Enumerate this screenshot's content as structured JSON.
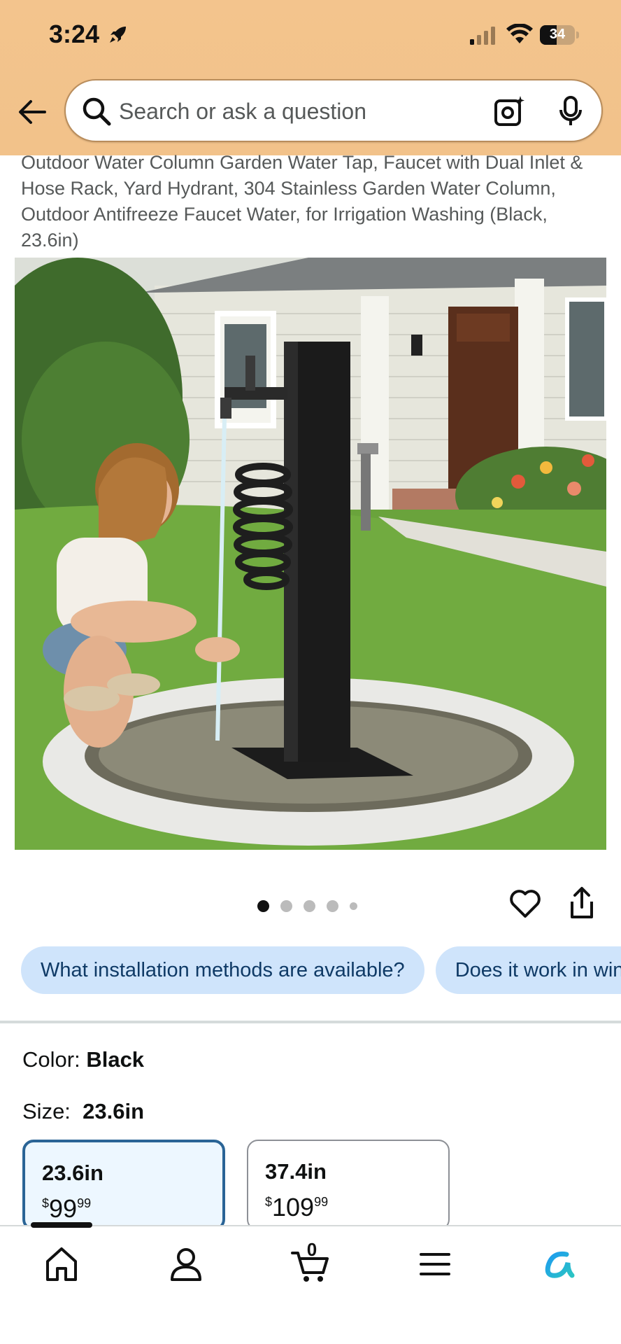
{
  "status_bar": {
    "time": "3:24",
    "battery": "34"
  },
  "search": {
    "placeholder": "Search or ask a question"
  },
  "product": {
    "title": "Outdoor Water Column Garden Water Tap, Faucet with Dual Inlet & Hose Rack, Yard Hydrant, 304 Stainless Garden Water Column, Outdoor Antifreeze Faucet Water, for Irrigation Washing (Black, 23.6in)"
  },
  "gallery": {
    "dot_count": 5,
    "active_index": 0
  },
  "questions": [
    "What installation methods are available?",
    "Does it work in winter?"
  ],
  "variants": {
    "color_label": "Color:",
    "color_value": "Black",
    "size_label": "Size:",
    "size_value": "23.6in",
    "sizes": [
      {
        "name": "23.6in",
        "currency": "$",
        "dollars": "99",
        "cents": "99",
        "selected": true
      },
      {
        "name": "37.4in",
        "currency": "$",
        "dollars": "109",
        "cents": "99",
        "selected": false
      }
    ]
  },
  "nav": {
    "cart_count": "0",
    "icons": [
      "home-icon",
      "account-icon",
      "cart-icon",
      "menu-icon",
      "rufus-icon"
    ]
  },
  "colors": {
    "header_bg": "#f2c28a",
    "chip_bg": "#cfe4fb",
    "selected_border": "#2a6496"
  }
}
